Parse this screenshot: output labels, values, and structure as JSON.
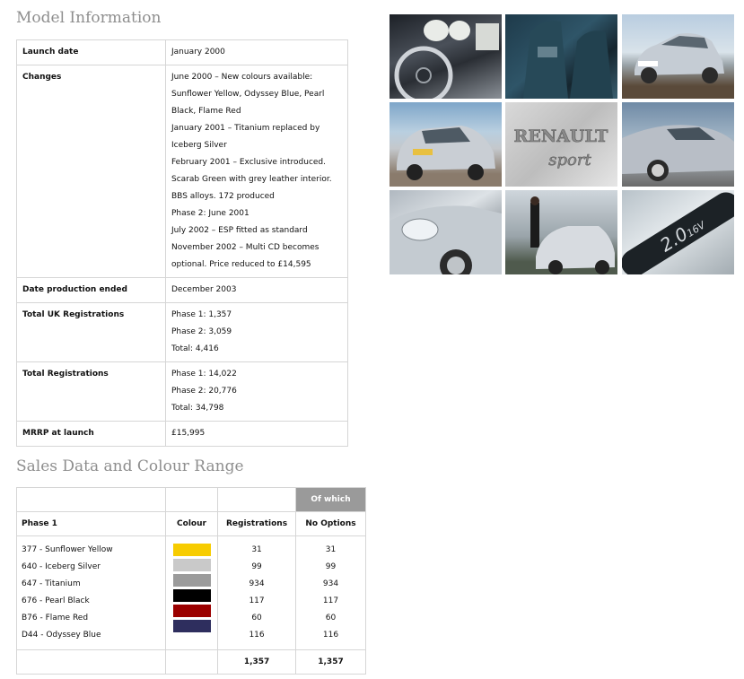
{
  "model_heading": "Model Information",
  "model_rows": [
    {
      "label": "Launch date",
      "lines": [
        "January 2000"
      ]
    },
    {
      "label": "Changes",
      "lines": [
        "June 2000 – New colours available:",
        "Sunflower Yellow, Odyssey Blue, Pearl",
        "Black, Flame Red",
        "January 2001 – Titanium replaced by",
        "Iceberg Silver",
        "February 2001 – Exclusive introduced.",
        "Scarab Green with grey leather interior.",
        "BBS alloys. 172 produced",
        "Phase 2: June 2001",
        "July 2002 – ESP fitted as standard",
        "November 2002 – Multi CD becomes",
        "optional. Price reduced to £14,595"
      ]
    },
    {
      "label": "Date production ended",
      "lines": [
        "December 2003"
      ]
    },
    {
      "label": "Total UK Registrations",
      "lines": [
        "Phase 1: 1,357",
        "Phase 2: 3,059",
        "Total: 4,416"
      ]
    },
    {
      "label": "Total Registrations",
      "lines": [
        "Phase 1: 14,022",
        "Phase 2: 20,776",
        "Total: 34,798"
      ]
    },
    {
      "label": "MRRP at launch",
      "lines": [
        "£15,995"
      ]
    }
  ],
  "sales_heading": "Sales Data and Colour Range",
  "sales": {
    "of_which_label": "Of which",
    "headers": {
      "phase": "Phase 1",
      "colour": "Colour",
      "registrations": "Registrations",
      "no_options": "No Options"
    },
    "rows": [
      {
        "name": "377 - Sunflower Yellow",
        "color": "#f7cc00",
        "registrations": "31",
        "no_options": "31"
      },
      {
        "name": "640 - Iceberg Silver",
        "color": "#c9c9c9",
        "registrations": "99",
        "no_options": "99"
      },
      {
        "name": "647 - Titanium",
        "color": "#9b9b9b",
        "registrations": "934",
        "no_options": "934"
      },
      {
        "name": "676 - Pearl Black",
        "color": "#000000",
        "registrations": "117",
        "no_options": "117"
      },
      {
        "name": "B76 - Flame Red",
        "color": "#9b0000",
        "registrations": "60",
        "no_options": "60"
      },
      {
        "name": "D44 - Odyssey Blue",
        "color": "#2e2e5e",
        "registrations": "116",
        "no_options": "116"
      }
    ],
    "totals": {
      "registrations": "1,357",
      "no_options": "1,357"
    }
  },
  "gallery": {
    "badge_text_1": "RENAULT",
    "badge_text_2": "sport",
    "logo_text": "2.0",
    "logo_sub": "16V"
  }
}
